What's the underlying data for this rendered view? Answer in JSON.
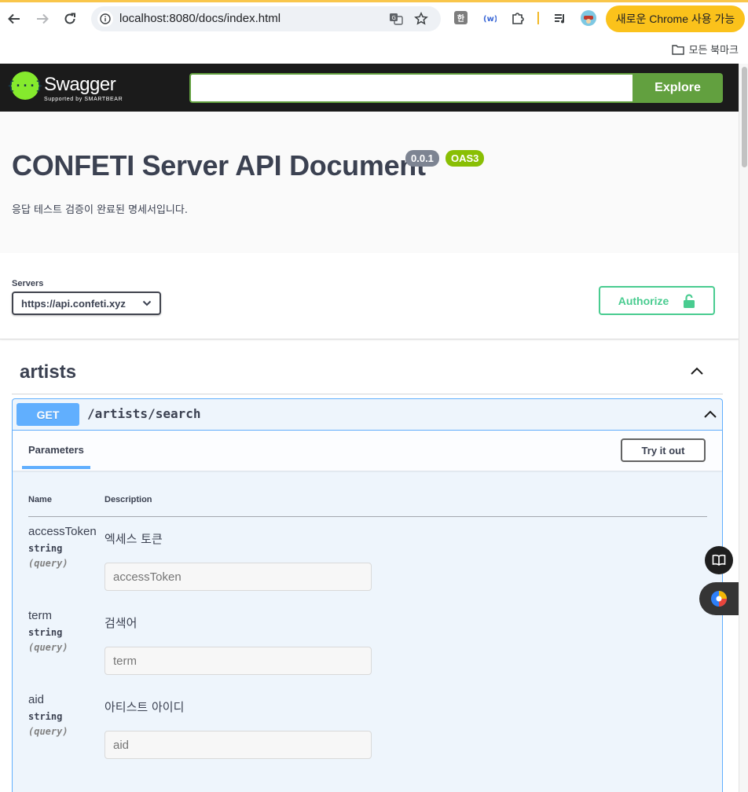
{
  "browser": {
    "url": "localhost:8080/docs/index.html",
    "extension_han": "한",
    "promo_label": "새로운 Chrome 사용 가능",
    "bookmarks_all": "모든 북마크"
  },
  "topbar": {
    "logo_text": "Swagger",
    "logo_sub": "Supported by SMARTBEAR",
    "logo_glyph": "{···}",
    "search_value": "",
    "explore_label": "Explore"
  },
  "info": {
    "title": "CONFETI Server API Document",
    "version": "0.0.1",
    "oas": "OAS3",
    "description": "응답 테스트 검증이 완료된 명세서입니다."
  },
  "servers": {
    "label": "Servers",
    "selected": "https://api.confeti.xyz"
  },
  "authorize_label": "Authorize",
  "tag": {
    "name": "artists"
  },
  "operation": {
    "method": "GET",
    "path": "/artists/search",
    "tab_label": "Parameters",
    "try_label": "Try it out",
    "col_name": "Name",
    "col_description": "Description",
    "params": [
      {
        "name": "accessToken",
        "type": "string",
        "in": "(query)",
        "description": "엑세스 토큰",
        "placeholder": "accessToken"
      },
      {
        "name": "term",
        "type": "string",
        "in": "(query)",
        "description": "검색어",
        "placeholder": "term"
      },
      {
        "name": "aid",
        "type": "string",
        "in": "(query)",
        "description": "아티스트 아이디",
        "placeholder": "aid"
      }
    ]
  },
  "colors": {
    "get": "#61affe",
    "authorize": "#49cc90",
    "explore": "#62a03f",
    "topbar": "#1b1b1b",
    "oas_badge": "#89bf04"
  }
}
